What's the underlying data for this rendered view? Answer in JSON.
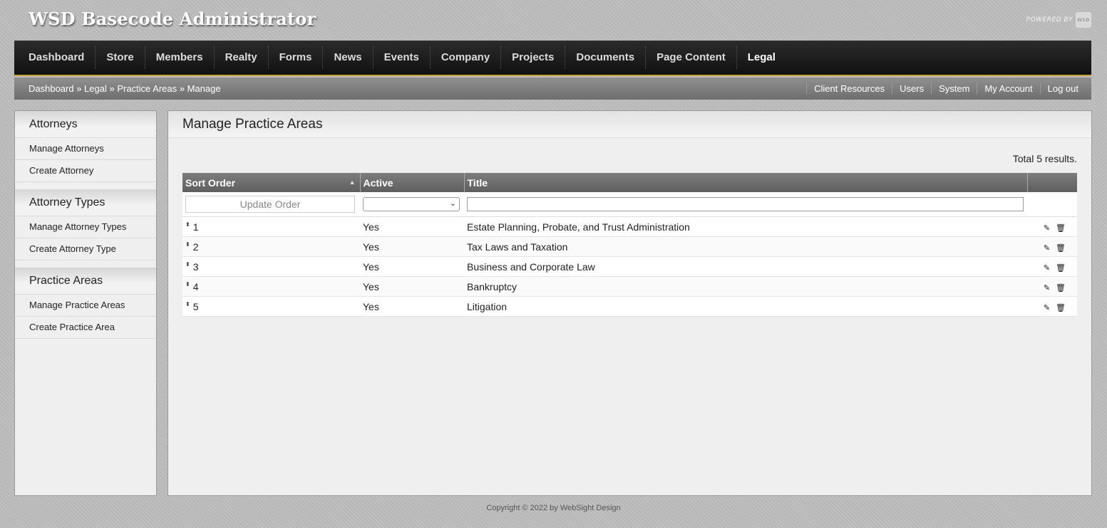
{
  "header": {
    "app_title": "WSD Basecode Administrator",
    "powered_by": "POWERED BY",
    "logo_text": "WSD"
  },
  "nav": {
    "items": [
      {
        "label": "Dashboard"
      },
      {
        "label": "Store"
      },
      {
        "label": "Members"
      },
      {
        "label": "Realty"
      },
      {
        "label": "Forms"
      },
      {
        "label": "News"
      },
      {
        "label": "Events"
      },
      {
        "label": "Company"
      },
      {
        "label": "Projects"
      },
      {
        "label": "Documents"
      },
      {
        "label": "Page Content"
      },
      {
        "label": "Legal"
      }
    ],
    "active": "Legal"
  },
  "subbar": {
    "breadcrumb": "Dashboard » Legal » Practice Areas » Manage",
    "links": [
      "Client Resources",
      "Users",
      "System",
      "My Account",
      "Log out"
    ]
  },
  "sidebar": {
    "sections": [
      {
        "title": "Attorneys",
        "items": [
          "Manage Attorneys",
          "Create Attorney"
        ]
      },
      {
        "title": "Attorney Types",
        "items": [
          "Manage Attorney Types",
          "Create Attorney Type"
        ]
      },
      {
        "title": "Practice Areas",
        "items": [
          "Manage Practice Areas",
          "Create Practice Area"
        ]
      }
    ]
  },
  "main": {
    "title": "Manage Practice Areas",
    "total_results": "Total 5 results.",
    "columns": [
      "Sort Order",
      "Active",
      "Title",
      ""
    ],
    "filters": {
      "update_order_label": "Update Order",
      "active_value": "",
      "title_value": ""
    },
    "rows": [
      {
        "order": "1",
        "active": "Yes",
        "title": "Estate Planning, Probate, and Trust Administration"
      },
      {
        "order": "2",
        "active": "Yes",
        "title": "Tax Laws and Taxation"
      },
      {
        "order": "3",
        "active": "Yes",
        "title": "Business and Corporate Law"
      },
      {
        "order": "4",
        "active": "Yes",
        "title": "Bankruptcy"
      },
      {
        "order": "5",
        "active": "Yes",
        "title": "Litigation"
      }
    ]
  },
  "footer": {
    "copyright": "Copyright © 2022 by WebSight Design"
  },
  "colors": {
    "nav_accent": "#c9a13b",
    "nav_bg": "#1a1a1a",
    "table_header_bg": "#6e6e6e"
  },
  "icons": {
    "drag_handle": "drag-handle-icon",
    "edit": "pencil-icon",
    "delete": "trash-icon",
    "sort": "sort-asc-icon"
  }
}
